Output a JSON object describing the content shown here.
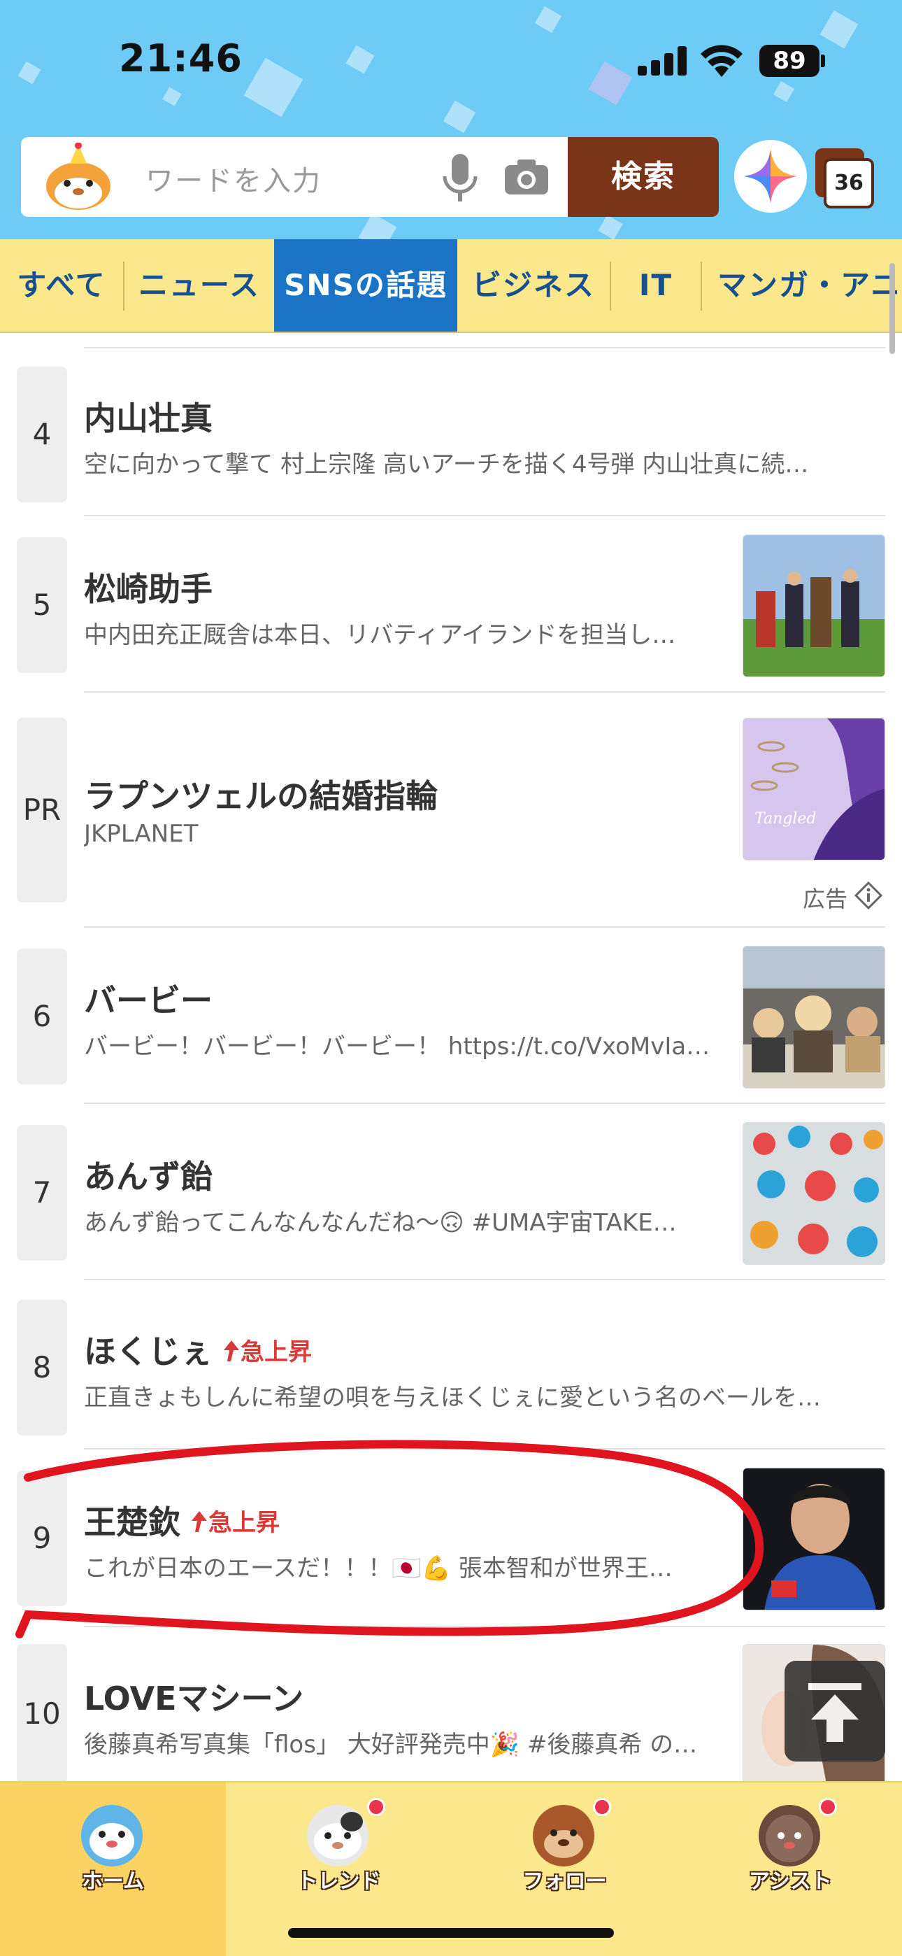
{
  "status_bar": {
    "time": "21:46",
    "battery": "89"
  },
  "search": {
    "placeholder": "ワードを入力",
    "button_label": "検索",
    "tabs_count": "36"
  },
  "categories": [
    {
      "label": "すべて"
    },
    {
      "label": "ニュース"
    },
    {
      "label": "SNSの話題",
      "active": true
    },
    {
      "label": "ビジネス"
    },
    {
      "label": "IT"
    },
    {
      "label": "マンガ・アニメ"
    }
  ],
  "list": [
    {
      "rank": "4",
      "title": "内山壮真",
      "desc": "空に向かって撃て 村上宗隆 高いアーチを描く4号弾 内山壮真に続…"
    },
    {
      "rank": "5",
      "title": "松崎助手",
      "desc": "中内田充正厩舎は本日、リバティアイランドを担当し…"
    },
    {
      "rank": "PR",
      "title": "ラプンツェルの結婚指輪",
      "desc": "JKPLANET",
      "ad_label": "広告",
      "thumb_text": "Tangled"
    },
    {
      "rank": "6",
      "title": "バービー",
      "desc": "バービー！バービー！バービー！ https://t.co/VxoMvIa…"
    },
    {
      "rank": "7",
      "title": "あんず飴",
      "desc": "あんず飴ってこんなんなんだね〜🙃 #UMA宇宙TAKE…"
    },
    {
      "rank": "8",
      "title": "ほくじぇ",
      "badge": "急上昇",
      "desc": "正直きょもしんに希望の唄を与えほくじぇに愛という名のベールを…"
    },
    {
      "rank": "9",
      "title": "王楚欽",
      "badge": "急上昇",
      "desc": "これが日本のエースだ！！！🇯🇵💪 張本智和が世界王…"
    },
    {
      "rank": "10",
      "title": "LOVEマシーン",
      "desc": "後藤真希写真集「flos」 大好評発売中🎉 #後藤真希 の…"
    }
  ],
  "bottom_nav": [
    {
      "label": "ホーム",
      "active": true
    },
    {
      "label": "トレンド",
      "badge": true
    },
    {
      "label": "フォロー",
      "badge": true
    },
    {
      "label": "アシスト",
      "badge": true
    }
  ],
  "colors": {
    "header_bg": "#6dcbf6",
    "category_bg": "#fbe88d",
    "category_active": "#1a73c4",
    "search_button": "#7a3418",
    "surge_red": "#d83a3a",
    "annotation_red": "#e0141e"
  }
}
